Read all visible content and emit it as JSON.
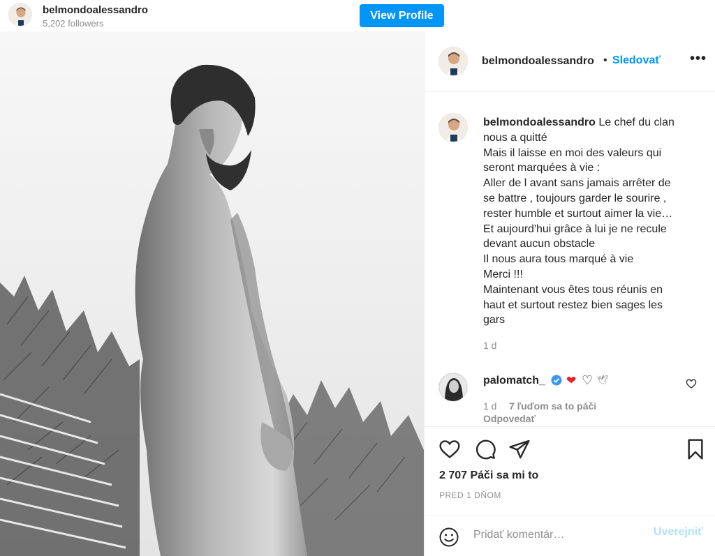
{
  "embed_header": {
    "username": "belmondoalessandro",
    "followers": "5,202 followers",
    "view_profile_label": "View Profile"
  },
  "post_header": {
    "username": "belmondoalessandro",
    "separator": "•",
    "follow_label": "Sledovať",
    "more_icon": "more-horizontal-icon",
    "more_label": "•••"
  },
  "caption": {
    "username": "belmondoalessandro",
    "lines": [
      "Le chef du clan",
      "nous a quitté",
      "Mais il laisse en moi des valeurs qui",
      "seront marquées à vie :",
      "Aller de l avant sans jamais arrêter de",
      "se battre , toujours garder le sourire ,",
      "rester humble et surtout aimer la vie…",
      "Et aujourd'hui grâce à lui je ne recule",
      "devant aucun obstacle",
      "Il nous aura tous marqué à vie",
      "Merci !!!",
      "Maintenant vous êtes tous réunis en",
      "haut et surtout restez bien sages les",
      "gars"
    ],
    "time": "1 d"
  },
  "comment": {
    "username": "palomatch_",
    "emojis": {
      "red_heart": "❤",
      "white_heart": "♡",
      "dove": "🕊"
    },
    "time": "1 d",
    "likes": "7 ľuďom sa to páči",
    "reply_label": "Odpovedať"
  },
  "actions": {
    "like_icon": "heart-icon",
    "comment_icon": "comment-icon",
    "share_icon": "share-icon",
    "save_icon": "bookmark-icon"
  },
  "likes_count": "2 707 Páči sa mi to",
  "post_time": "PRED 1 DŇOM",
  "comment_box": {
    "placeholder": "Pridať komentár…",
    "post_label": "Uverejniť"
  },
  "colors": {
    "accent": "#0095f6",
    "post_disabled": "#b2dffc",
    "secondary_text": "#8e8e8e",
    "heart_red": "#ed1c24"
  }
}
